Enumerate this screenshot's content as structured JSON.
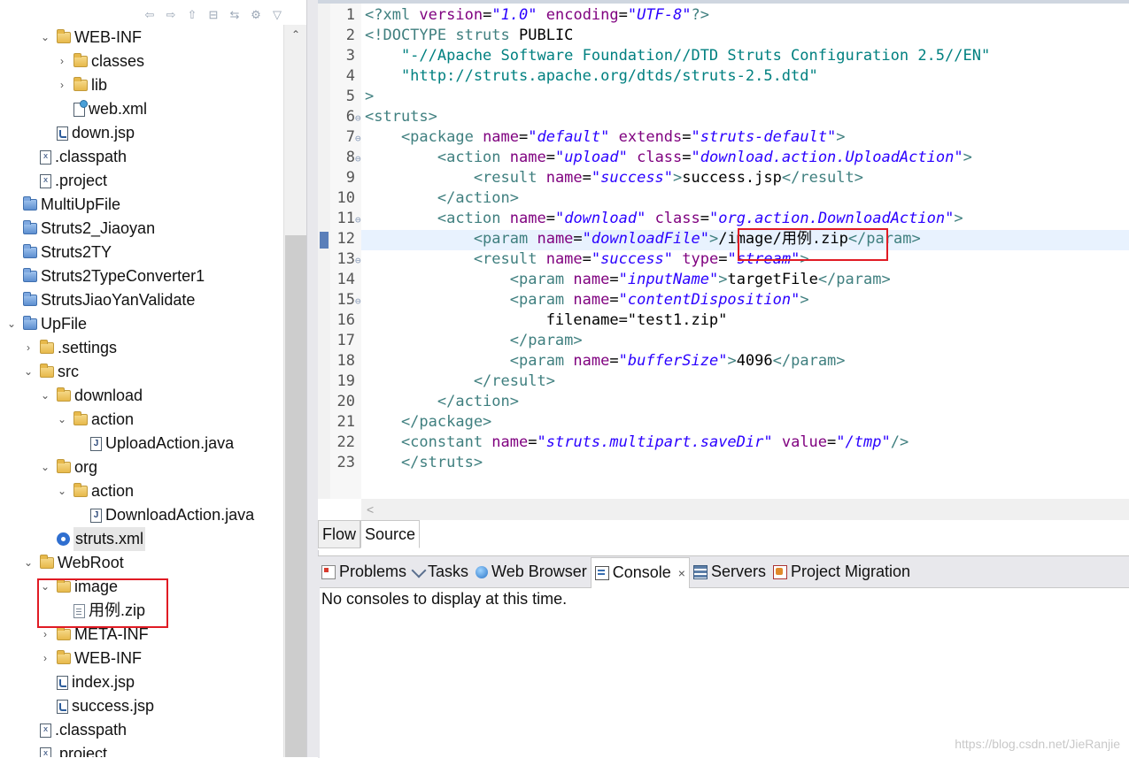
{
  "explorer": {
    "items": [
      {
        "label": "WEB-INF",
        "icon": "folder-open-icon",
        "expand": "open",
        "depth": 2
      },
      {
        "label": "classes",
        "icon": "folder-open-icon",
        "expand": "closed",
        "depth": 3
      },
      {
        "label": "lib",
        "icon": "folder-open-icon",
        "expand": "closed",
        "depth": 3
      },
      {
        "label": "web.xml",
        "icon": "xml-file-icon",
        "expand": "none",
        "depth": 3
      },
      {
        "label": "down.jsp",
        "icon": "jsp-file-icon",
        "expand": "none",
        "depth": 2
      },
      {
        "label": ".classpath",
        "icon": "xml-file-icon",
        "expand": "none",
        "depth": 1
      },
      {
        "label": ".project",
        "icon": "xml-file-icon",
        "expand": "none",
        "depth": 1
      },
      {
        "label": "MultiUpFile",
        "icon": "project-icon",
        "expand": "none",
        "depth": 0
      },
      {
        "label": "Struts2_Jiaoyan",
        "icon": "project-icon",
        "expand": "none",
        "depth": 0
      },
      {
        "label": "Struts2TY",
        "icon": "project-icon",
        "expand": "none",
        "depth": 0
      },
      {
        "label": "Struts2TypeConverter1",
        "icon": "project-icon",
        "expand": "none",
        "depth": 0
      },
      {
        "label": "StrutsJiaoYanValidate",
        "icon": "project-icon",
        "expand": "none",
        "depth": 0
      },
      {
        "label": "UpFile",
        "icon": "project-icon",
        "expand": "open",
        "depth": 0
      },
      {
        "label": ".settings",
        "icon": "folder-open-icon",
        "expand": "closed",
        "depth": 1
      },
      {
        "label": "src",
        "icon": "folder-open-icon",
        "expand": "open",
        "depth": 1
      },
      {
        "label": "download",
        "icon": "folder-open-icon",
        "expand": "open",
        "depth": 2
      },
      {
        "label": "action",
        "icon": "folder-open-icon",
        "expand": "open",
        "depth": 3
      },
      {
        "label": "UploadAction.java",
        "icon": "java-file-icon",
        "expand": "none",
        "depth": 4
      },
      {
        "label": "org",
        "icon": "folder-open-icon",
        "expand": "open",
        "depth": 2
      },
      {
        "label": "action",
        "icon": "folder-open-icon",
        "expand": "open",
        "depth": 3
      },
      {
        "label": "DownloadAction.java",
        "icon": "java-file-icon",
        "expand": "none",
        "depth": 4
      },
      {
        "label": "struts.xml",
        "icon": "gear-icon",
        "expand": "none",
        "depth": 2,
        "selected": true
      },
      {
        "label": "WebRoot",
        "icon": "folder-open-icon",
        "expand": "open",
        "depth": 1
      },
      {
        "label": "image",
        "icon": "folder-open-icon",
        "expand": "open",
        "depth": 2
      },
      {
        "label": "用例.zip",
        "icon": "file-icon",
        "expand": "none",
        "depth": 3
      },
      {
        "label": "META-INF",
        "icon": "folder-open-icon",
        "expand": "closed",
        "depth": 2
      },
      {
        "label": "WEB-INF",
        "icon": "folder-open-icon",
        "expand": "closed",
        "depth": 2
      },
      {
        "label": "index.jsp",
        "icon": "jsp-file-icon",
        "expand": "none",
        "depth": 2
      },
      {
        "label": "success.jsp",
        "icon": "jsp-file-icon",
        "expand": "none",
        "depth": 2
      },
      {
        "label": ".classpath",
        "icon": "xml-file-icon",
        "expand": "none",
        "depth": 1
      },
      {
        "label": ".project",
        "icon": "xml-file-icon",
        "expand": "none",
        "depth": 1
      }
    ]
  },
  "editor": {
    "lines": [
      {
        "n": "1",
        "fold": "",
        "segs": [
          [
            "t",
            "<?xml "
          ],
          [
            "a",
            "version"
          ],
          [
            "",
            "="
          ],
          [
            "s",
            "\"1.0\""
          ],
          [
            "a",
            " encoding"
          ],
          [
            "",
            "="
          ],
          [
            "s",
            "\"UTF-8\""
          ],
          [
            "t",
            "?>"
          ]
        ]
      },
      {
        "n": "2",
        "fold": "",
        "segs": [
          [
            "t",
            "<!DOCTYPE struts "
          ],
          [
            "",
            "PUBLIC"
          ]
        ]
      },
      {
        "n": "3",
        "fold": "",
        "segs": [
          [
            "d",
            "    \"-//Apache Software Foundation//DTD Struts Configuration 2.5//EN\""
          ]
        ]
      },
      {
        "n": "4",
        "fold": "",
        "segs": [
          [
            "d",
            "    \"http://struts.apache.org/dtds/struts-2.5.dtd\""
          ]
        ]
      },
      {
        "n": "5",
        "fold": "",
        "segs": [
          [
            "t",
            ">"
          ]
        ]
      },
      {
        "n": "6",
        "fold": "⊖",
        "segs": [
          [
            "t",
            "<struts>"
          ]
        ]
      },
      {
        "n": "7",
        "fold": "⊖",
        "segs": [
          [
            "t",
            "    <package "
          ],
          [
            "a",
            "name"
          ],
          [
            "",
            "="
          ],
          [
            "s",
            "\"default\""
          ],
          [
            "a",
            " extends"
          ],
          [
            "",
            "="
          ],
          [
            "s",
            "\"struts-default\""
          ],
          [
            "t",
            ">"
          ]
        ]
      },
      {
        "n": "8",
        "fold": "⊖",
        "segs": [
          [
            "t",
            "        <action "
          ],
          [
            "a",
            "name"
          ],
          [
            "",
            "="
          ],
          [
            "s",
            "\"upload\""
          ],
          [
            "a",
            " class"
          ],
          [
            "",
            "="
          ],
          [
            "s",
            "\"download.action.UploadAction\""
          ],
          [
            "t",
            ">"
          ]
        ]
      },
      {
        "n": "9",
        "fold": "",
        "segs": [
          [
            "t",
            "            <result "
          ],
          [
            "a",
            "name"
          ],
          [
            "",
            "="
          ],
          [
            "s",
            "\"success\""
          ],
          [
            "t",
            ">"
          ],
          [
            "",
            "success.jsp"
          ],
          [
            "t",
            "</result>"
          ]
        ]
      },
      {
        "n": "10",
        "fold": "",
        "segs": [
          [
            "t",
            "        </action>"
          ]
        ]
      },
      {
        "n": "11",
        "fold": "⊖",
        "segs": [
          [
            "t",
            "        <action "
          ],
          [
            "a",
            "name"
          ],
          [
            "",
            "="
          ],
          [
            "s",
            "\"download\""
          ],
          [
            "a",
            " class"
          ],
          [
            "",
            "="
          ],
          [
            "s",
            "\"org.action.DownloadAction\""
          ],
          [
            "t",
            ">"
          ]
        ]
      },
      {
        "n": "12",
        "fold": "",
        "segs": [
          [
            "t",
            "            <param "
          ],
          [
            "a",
            "name"
          ],
          [
            "",
            "="
          ],
          [
            "s",
            "\"downloadFile\""
          ],
          [
            "t",
            ">"
          ],
          [
            "",
            "/image/用例.zip"
          ],
          [
            "t",
            "</param>"
          ]
        ]
      },
      {
        "n": "13",
        "fold": "⊖",
        "segs": [
          [
            "t",
            "            <result "
          ],
          [
            "a",
            "name"
          ],
          [
            "",
            "="
          ],
          [
            "s",
            "\"success\""
          ],
          [
            "a",
            " type"
          ],
          [
            "",
            "="
          ],
          [
            "s",
            "\"stream\""
          ],
          [
            "t",
            ">"
          ]
        ]
      },
      {
        "n": "14",
        "fold": "",
        "segs": [
          [
            "t",
            "                <param "
          ],
          [
            "a",
            "name"
          ],
          [
            "",
            "="
          ],
          [
            "s",
            "\"inputName\""
          ],
          [
            "t",
            ">"
          ],
          [
            "",
            "targetFile"
          ],
          [
            "t",
            "</param>"
          ]
        ]
      },
      {
        "n": "15",
        "fold": "⊖",
        "segs": [
          [
            "t",
            "                <param "
          ],
          [
            "a",
            "name"
          ],
          [
            "",
            "="
          ],
          [
            "s",
            "\"contentDisposition\""
          ],
          [
            "t",
            ">"
          ]
        ]
      },
      {
        "n": "16",
        "fold": "",
        "segs": [
          [
            "",
            "                    filename=\"test1.zip\""
          ]
        ]
      },
      {
        "n": "17",
        "fold": "",
        "segs": [
          [
            "t",
            "                </param>"
          ]
        ]
      },
      {
        "n": "18",
        "fold": "",
        "segs": [
          [
            "t",
            "                <param "
          ],
          [
            "a",
            "name"
          ],
          [
            "",
            "="
          ],
          [
            "s",
            "\"bufferSize\""
          ],
          [
            "t",
            ">"
          ],
          [
            "",
            "4096"
          ],
          [
            "t",
            "</param>"
          ]
        ]
      },
      {
        "n": "19",
        "fold": "",
        "segs": [
          [
            "t",
            "            </result>"
          ]
        ]
      },
      {
        "n": "20",
        "fold": "",
        "segs": [
          [
            "t",
            "        </action>"
          ]
        ]
      },
      {
        "n": "21",
        "fold": "",
        "segs": [
          [
            "t",
            "    </package>"
          ]
        ]
      },
      {
        "n": "22",
        "fold": "",
        "segs": [
          [
            "t",
            "    <constant "
          ],
          [
            "a",
            "name"
          ],
          [
            "",
            "="
          ],
          [
            "s",
            "\"struts.multipart.saveDir\""
          ],
          [
            "a",
            " value"
          ],
          [
            "",
            "="
          ],
          [
            "s",
            "\"/tmp\""
          ],
          [
            "t",
            "/>"
          ]
        ]
      },
      {
        "n": "23",
        "fold": "",
        "segs": [
          [
            "t",
            "    </struts>"
          ]
        ]
      }
    ],
    "tabs": {
      "flow": "Flow",
      "source": "Source"
    }
  },
  "bottom_panel": {
    "tabs": [
      {
        "label": "Problems",
        "icon": "problems-icon"
      },
      {
        "label": "Tasks",
        "icon": "tasks-icon"
      },
      {
        "label": "Web Browser",
        "icon": "web-browser-icon"
      },
      {
        "label": "Console",
        "icon": "console-icon",
        "active": true,
        "closable": "×"
      },
      {
        "label": "Servers",
        "icon": "servers-icon"
      },
      {
        "label": "Project Migration",
        "icon": "project-migration-icon"
      }
    ],
    "console_message": "No consoles to display at this time."
  },
  "watermark": "https://blog.csdn.net/JieRanjie",
  "colors": {
    "highlight_box": "#e01b24",
    "current_line": "#e8f2fe"
  }
}
